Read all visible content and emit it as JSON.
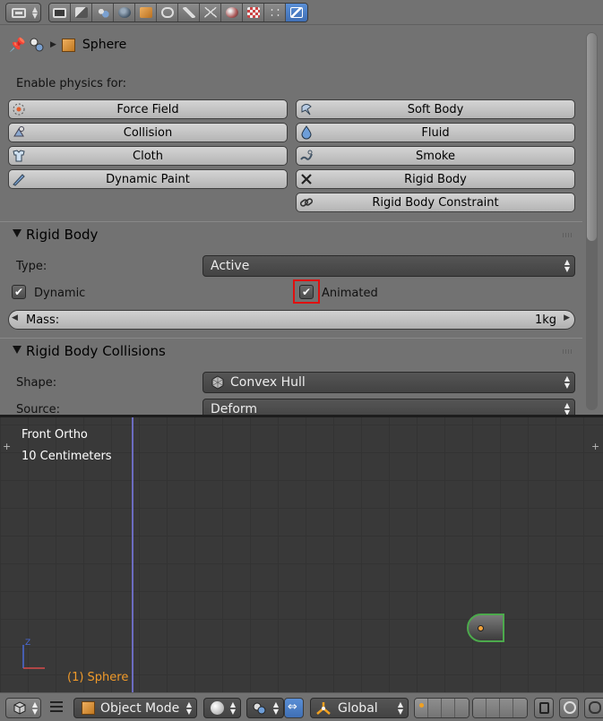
{
  "properties": {
    "tabs": [
      "render-tab",
      "render-layers-tab",
      "scene-tab",
      "world-tab",
      "object-tab",
      "constraints-tab",
      "modifiers-tab",
      "data-tab",
      "material-tab",
      "texture-tab",
      "particles-tab",
      "physics-tab"
    ],
    "active_tab": "physics-tab",
    "breadcrumb": {
      "object_name": "Sphere"
    },
    "enable_physics_label": "Enable physics for:",
    "physics_buttons_left": [
      {
        "label": "Force Field",
        "icon": "force-field-icon"
      },
      {
        "label": "Collision",
        "icon": "collision-icon"
      },
      {
        "label": "Cloth",
        "icon": "cloth-icon"
      },
      {
        "label": "Dynamic Paint",
        "icon": "dynamic-paint-icon"
      }
    ],
    "physics_buttons_right": [
      {
        "label": "Soft Body",
        "icon": "soft-body-icon"
      },
      {
        "label": "Fluid",
        "icon": "fluid-icon"
      },
      {
        "label": "Smoke",
        "icon": "smoke-icon"
      },
      {
        "label": "Rigid Body",
        "icon": "close-x-icon"
      },
      {
        "label": "Rigid Body Constraint",
        "icon": "chain-link-icon"
      }
    ],
    "rigid_body": {
      "title": "Rigid Body",
      "type_label": "Type:",
      "type_value": "Active",
      "dynamic_label": "Dynamic",
      "dynamic_checked": true,
      "animated_label": "Animated",
      "animated_checked": true,
      "mass_label": "Mass:",
      "mass_value": "1kg"
    },
    "collisions": {
      "title": "Rigid Body Collisions",
      "shape_label": "Shape:",
      "shape_value": "Convex Hull",
      "source_label": "Source:",
      "source_value": "Deform"
    }
  },
  "viewport": {
    "view_name": "Front Ortho",
    "grid_scale": "10 Centimeters",
    "object_label": "(1) Sphere",
    "axis_z": "Z"
  },
  "header": {
    "mode": "Object Mode",
    "orientation": "Global"
  },
  "colors": {
    "highlight": "#e01010",
    "active_tab": "#4f80c8",
    "selected_outline": "#4caa4c",
    "object_label": "#f09a2a"
  }
}
